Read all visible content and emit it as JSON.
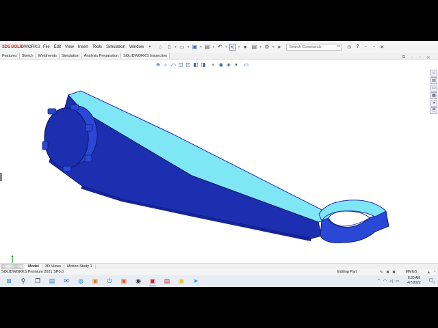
{
  "app": {
    "brand_prefix": "3DS",
    "brand_solid": "SOLID",
    "brand_works": "WORKS"
  },
  "menu": [
    "File",
    "Edit",
    "View",
    "Insert",
    "Tools",
    "Simulation",
    "Window"
  ],
  "search": {
    "placeholder": "Search Commands"
  },
  "command_tabs": [
    "Features",
    "Sketch",
    "Weldments",
    "Simulation",
    "Analysis Preparation",
    "SOLIDWORKS Inspection"
  ],
  "model_tabs": [
    "Model",
    "3D Views",
    "Motion Study 1"
  ],
  "status": {
    "product": "SOLIDWORKS Premium 2021 SP0.0",
    "mode": "Editing Part",
    "units": "MMGS"
  },
  "clock": {
    "time": "8:30 AM",
    "date": "4/7/2022"
  },
  "notifications": "2",
  "colors": {
    "part_dark": "#1c2fb0",
    "part_mid": "#2a48d6",
    "part_light": "#7fe6f6",
    "accent": "#3b78c4"
  }
}
